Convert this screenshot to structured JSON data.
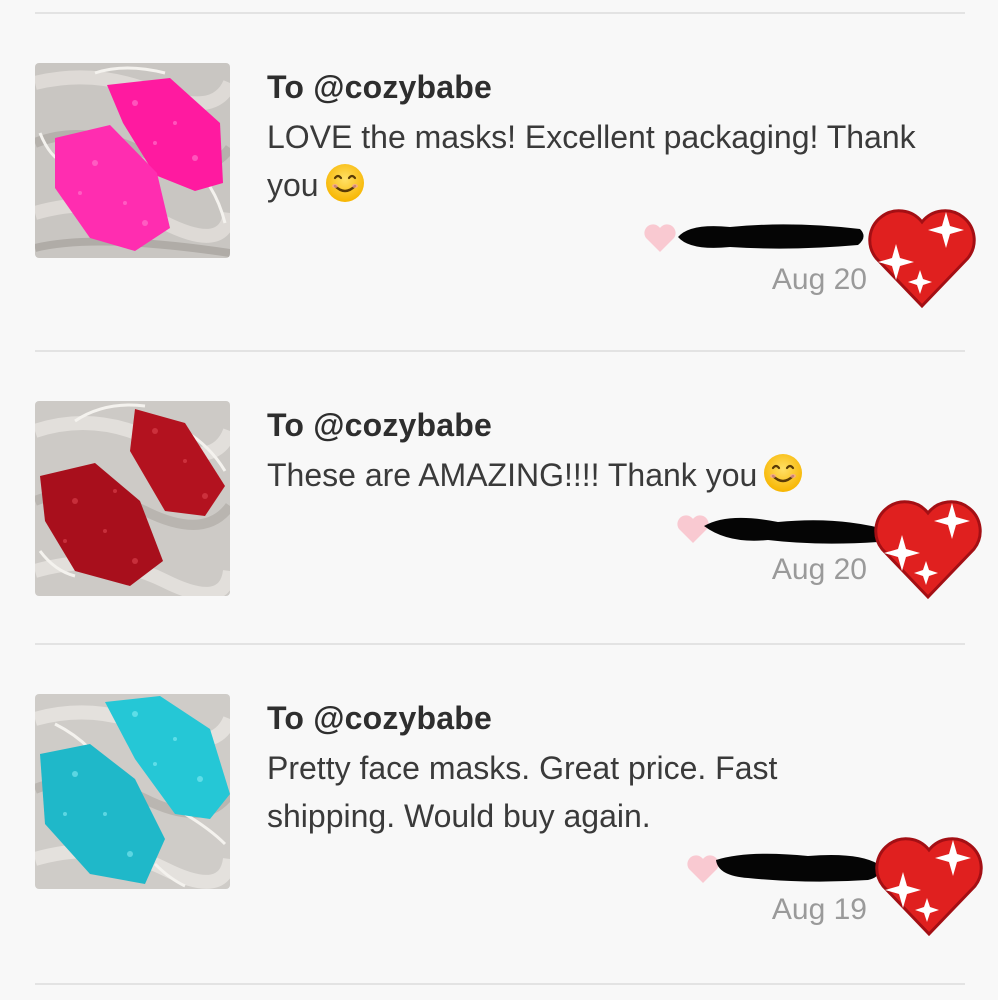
{
  "reviews": [
    {
      "to": "To @cozybabe",
      "text": "LOVE the masks! Excellent packaging! Thank you",
      "has_emoji": true,
      "emoji": "smiling-face-icon",
      "date": "Aug 20",
      "mask_color": "#ff1aa0",
      "mask_color_dark": "#d6007e"
    },
    {
      "to": "To @cozybabe",
      "text": "These are AMAZING!!!! Thank you",
      "has_emoji": true,
      "emoji": "smiling-face-icon",
      "date": "Aug 20",
      "mask_color": "#b3121f",
      "mask_color_dark": "#7d0a14"
    },
    {
      "to": "To @cozybabe",
      "text": "Pretty face masks. Great price. Fast shipping. Would buy again.",
      "has_emoji": false,
      "date": "Aug 19",
      "mask_color": "#25c7d6",
      "mask_color_dark": "#0f96a6"
    }
  ],
  "colors": {
    "like_heart": "#f9c9d1",
    "sparkle_heart": "#e0201f",
    "divider": "#e3e3e3",
    "background": "#f8f8f8"
  },
  "icons": {
    "like": "heart-icon",
    "sticker": "sparkling-heart-icon"
  }
}
